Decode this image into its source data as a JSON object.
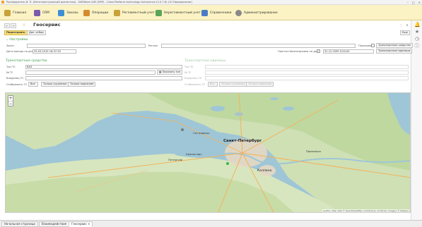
{
  "window": {
    "title": "Руководитель И. П. (Интеллектуальный диспетчер) - DATAKom LMS (ERP) - Cross Platform technology fortuniance (2.0.7.6) (1С:Предприятие)"
  },
  "menu": {
    "items": [
      {
        "label": "Главная",
        "color": "#c9a23a"
      },
      {
        "label": "CRM",
        "color": "#7a5bb0"
      },
      {
        "label": "Заказы",
        "color": "#3d8fd4"
      },
      {
        "label": "Операции",
        "color": "#d48a2f"
      },
      {
        "label": "Регламентный учет",
        "color": "#c9a23a"
      },
      {
        "label": "Нерегламентный учет",
        "color": "#5aa45a"
      },
      {
        "label": "Справочники",
        "color": "#4b7bc4"
      },
      {
        "label": "Администрирование",
        "color": "#888888"
      }
    ]
  },
  "page": {
    "title": "Геосервис",
    "more_label": "Еще"
  },
  "toolbar": {
    "refresh_label": "Перестроить",
    "data_label": "Доп. отбор"
  },
  "settings": {
    "section_label": "Настройки",
    "order_label": "Заказ",
    "region_label": "Регион",
    "delivery_date_label": "Дата выезда на дату",
    "delivery_date_value": "25.03.2019 16:37:35",
    "show_label": "Показывать",
    "forecast_label": "Прогноз балансировки на дату",
    "forecast_checked": true,
    "forecast_value": "31.12.2099 0:00:00",
    "transport_btn": "Транспортные средства",
    "units_btn": "Транспортные единицы"
  },
  "transport": {
    "section_label": "Транспортные средства",
    "type_label": "Тип ТС",
    "type_value": "ВАЗ",
    "num_label": "№ ТС",
    "show_label": "Показать тип",
    "owner_label": "Владелец ТС",
    "display_label": "Отображать ТС",
    "buttons": [
      "Все",
      "Только груженые",
      "Только порожние"
    ]
  },
  "units": {
    "section_label": "Транспортные единицы",
    "type_label": "Тип ТЕ",
    "num_label": "№ ТЕ",
    "owner_label": "Владелец ТЕ",
    "display_label": "Отображать ТЕ",
    "buttons": [
      "Все",
      "Только груженые",
      "Только порожние"
    ]
  },
  "map": {
    "cities": [
      "Санкт-Петербург",
      "Колпино",
      "Сестрорецк",
      "Кронштадт",
      "Петергоф",
      "Приозерск"
    ],
    "attribution": "Leaflet | Map data © OpenStreetMap contributors, CC-BY-SA, Imagery © Mapbox"
  },
  "tabs": [
    "Начальная страница",
    "Взаимодействия",
    "Геосервис"
  ]
}
